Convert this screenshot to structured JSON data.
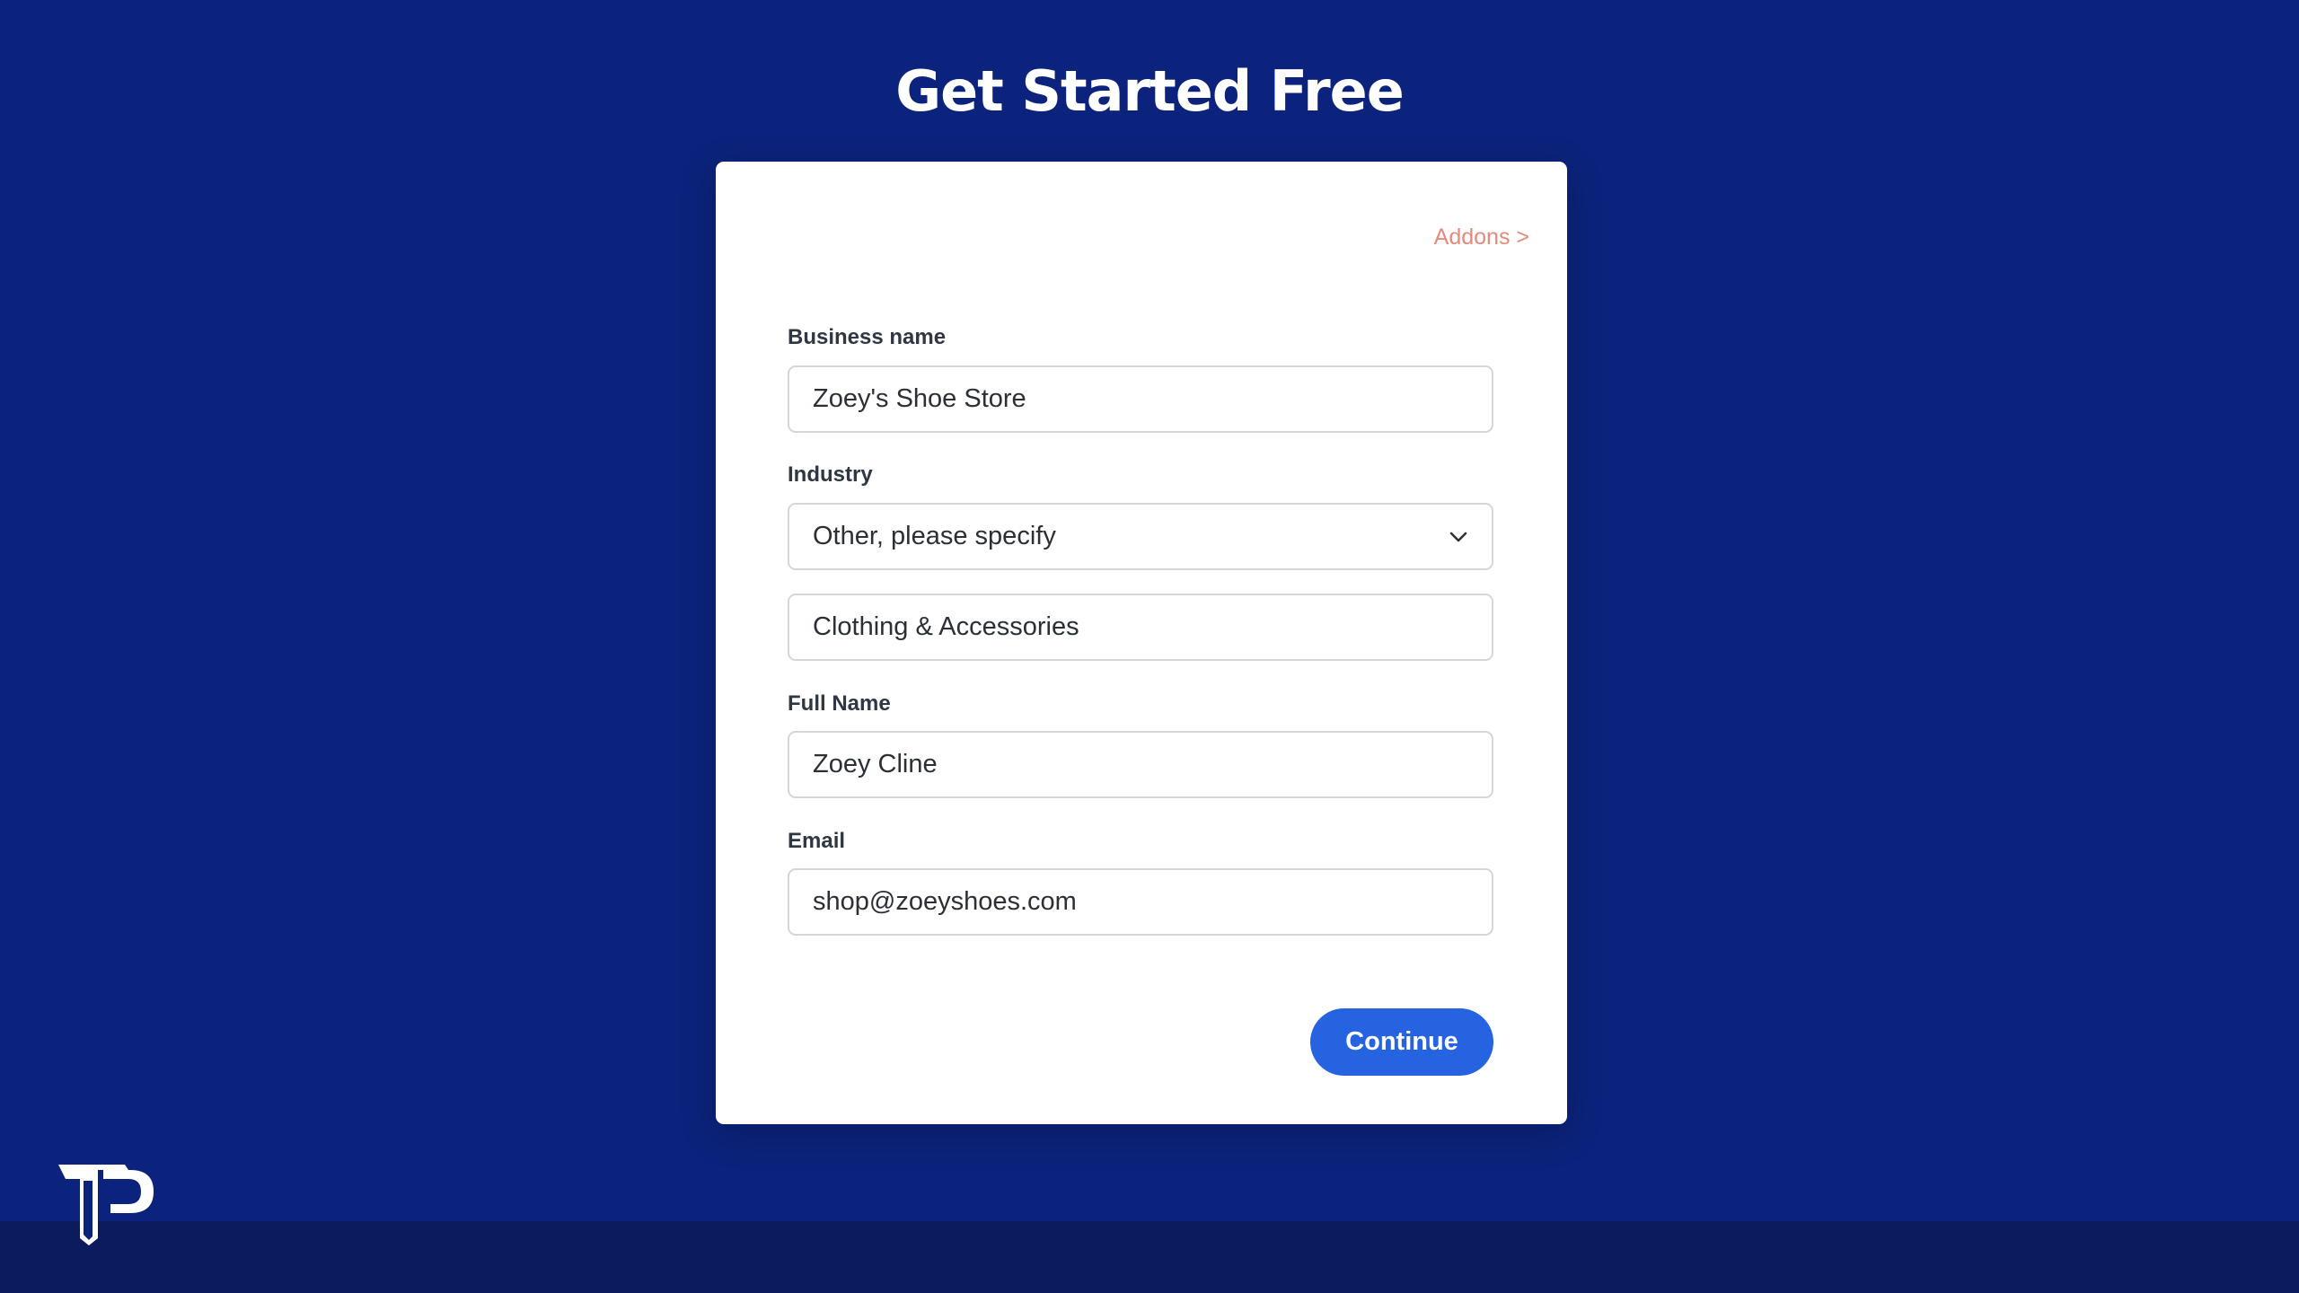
{
  "page": {
    "title": "Get Started Free"
  },
  "card": {
    "addons_link": "Addons >"
  },
  "form": {
    "business_name": {
      "label": "Business name",
      "value": "Zoey's Shoe Store"
    },
    "industry": {
      "label": "Industry",
      "selected": "Other, please specify",
      "other_value": "Clothing & Accessories"
    },
    "full_name": {
      "label": "Full Name",
      "value": "Zoey Cline"
    },
    "email": {
      "label": "Email",
      "value": "shop@zoeyshoes.com"
    },
    "continue_label": "Continue"
  },
  "icons": {
    "select_chevron": "chevron-down-icon",
    "brand_logo": "tp-logo"
  },
  "colors": {
    "background": "#0b237c",
    "bottom_bar": "#0a1c5e",
    "card": "#ffffff",
    "link": "#e6897c",
    "primary_button": "#2563e0"
  }
}
